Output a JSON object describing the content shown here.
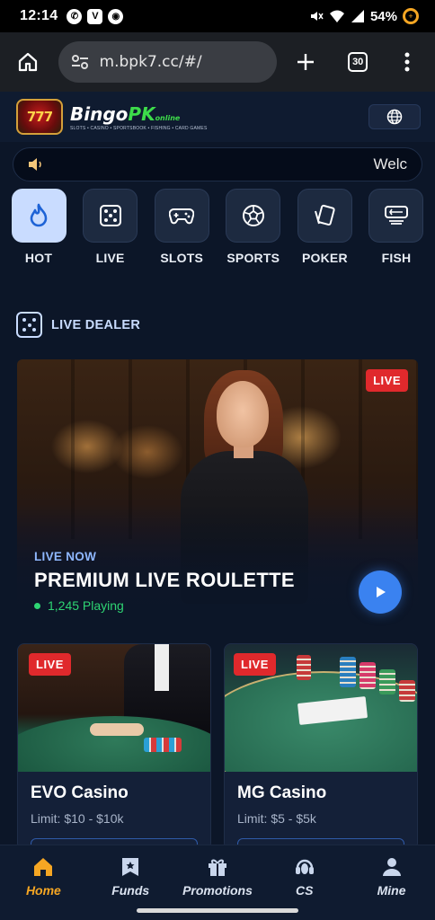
{
  "status_bar": {
    "time": "12:14",
    "battery": "54%"
  },
  "browser": {
    "url": "m.bpk7.cc/#/",
    "tab_count": "30"
  },
  "header": {
    "logo_badge": "777",
    "logo_text": "Bingo",
    "logo_text_accent": "PK",
    "logo_suffix": "online",
    "logo_tagline": "SLOTS • CASINO • SPORTSBOOK • FISHING • CARD GAMES"
  },
  "marquee": {
    "text": "Welc"
  },
  "categories": [
    {
      "label": "HOT",
      "icon": "fire-icon",
      "active": true
    },
    {
      "label": "LIVE",
      "icon": "dice-icon"
    },
    {
      "label": "SLOTS",
      "icon": "gamepad-icon"
    },
    {
      "label": "SPORTS",
      "icon": "soccer-ball-icon"
    },
    {
      "label": "POKER",
      "icon": "cards-icon"
    },
    {
      "label": "FISH",
      "icon": "fish-icon"
    }
  ],
  "section": {
    "title": "LIVE DEALER"
  },
  "hero": {
    "badge": "LIVE",
    "subtitle": "LIVE NOW",
    "title": "PREMIUM LIVE ROULETTE",
    "playing": "1,245 Playing"
  },
  "cards": [
    {
      "badge": "LIVE",
      "title": "EVO Casino",
      "limit": "Limit: $10 - $10k"
    },
    {
      "badge": "LIVE",
      "title": "MG Casino",
      "limit": "Limit: $5 - $5k"
    }
  ],
  "nav": [
    {
      "label": "Home",
      "icon": "home-icon",
      "active": true
    },
    {
      "label": "Funds",
      "icon": "bookmark-icon"
    },
    {
      "label": "Promotions",
      "icon": "gift-icon"
    },
    {
      "label": "CS",
      "icon": "headset-icon"
    },
    {
      "label": "Mine",
      "icon": "user-icon"
    }
  ],
  "colors": {
    "accent": "#f5a623",
    "live_red": "#e0292c",
    "primary_blue": "#3a82f0",
    "active_cat": "#c9dcff"
  }
}
